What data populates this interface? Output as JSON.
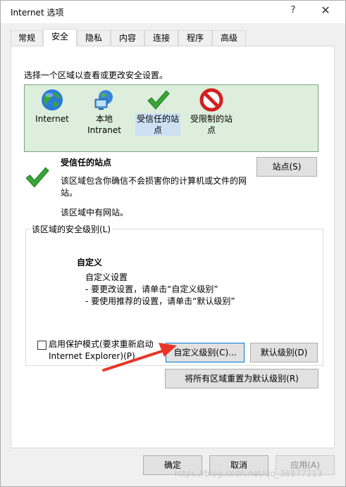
{
  "window": {
    "title": "Internet 选项",
    "help_glyph": "?",
    "close_glyph": "✕"
  },
  "tabs": [
    {
      "label": "常规",
      "active": false
    },
    {
      "label": "安全",
      "active": true
    },
    {
      "label": "隐私",
      "active": false
    },
    {
      "label": "内容",
      "active": false
    },
    {
      "label": "连接",
      "active": false
    },
    {
      "label": "程序",
      "active": false
    },
    {
      "label": "高级",
      "active": false
    }
  ],
  "security": {
    "zone_prompt": "选择一个区域以查看或更改安全设置。",
    "zones": [
      {
        "label": "Internet",
        "icon": "globe-icon"
      },
      {
        "label": "本地\nIntranet",
        "icon": "intranet-icon"
      },
      {
        "label": "受信任的站\n点",
        "icon": "green-check-icon",
        "selected": true
      },
      {
        "label": "受限制的站\n点",
        "icon": "no-entry-icon"
      }
    ],
    "selected_zone": {
      "title": "受信任的站点",
      "description": "该区域包含你确信不会损害你的计算机或文件的网站。",
      "note": "该区域中有网站。"
    },
    "sites_button": "站点(S)",
    "level_group_label": "该区域的安全级别(L)",
    "level_title": "自定义",
    "level_lines": [
      "自定义设置",
      "- 要更改设置，请单击“自定义级别”",
      "- 要使用推荐的设置，请单击“默认级别”"
    ],
    "protected_mode": {
      "label": "启用保护模式(要求重新启动 Internet Explorer)(P)",
      "checked": false
    },
    "custom_level_button": "自定义级别(C)...",
    "default_level_button": "默认级别(D)",
    "reset_all_button": "将所有区域重置为默认级别(R)"
  },
  "footer": {
    "ok": "确定",
    "cancel": "取消",
    "apply": "应用(A)"
  },
  "watermark": "https://blog.csdn.net/qq_36877213",
  "colors": {
    "zone_bg": "#ddeedd",
    "zone_border": "#79a27b",
    "selected_zone_bg": "#cde0f4",
    "arrow": "#e8352a",
    "focus_border": "#0078d7"
  }
}
